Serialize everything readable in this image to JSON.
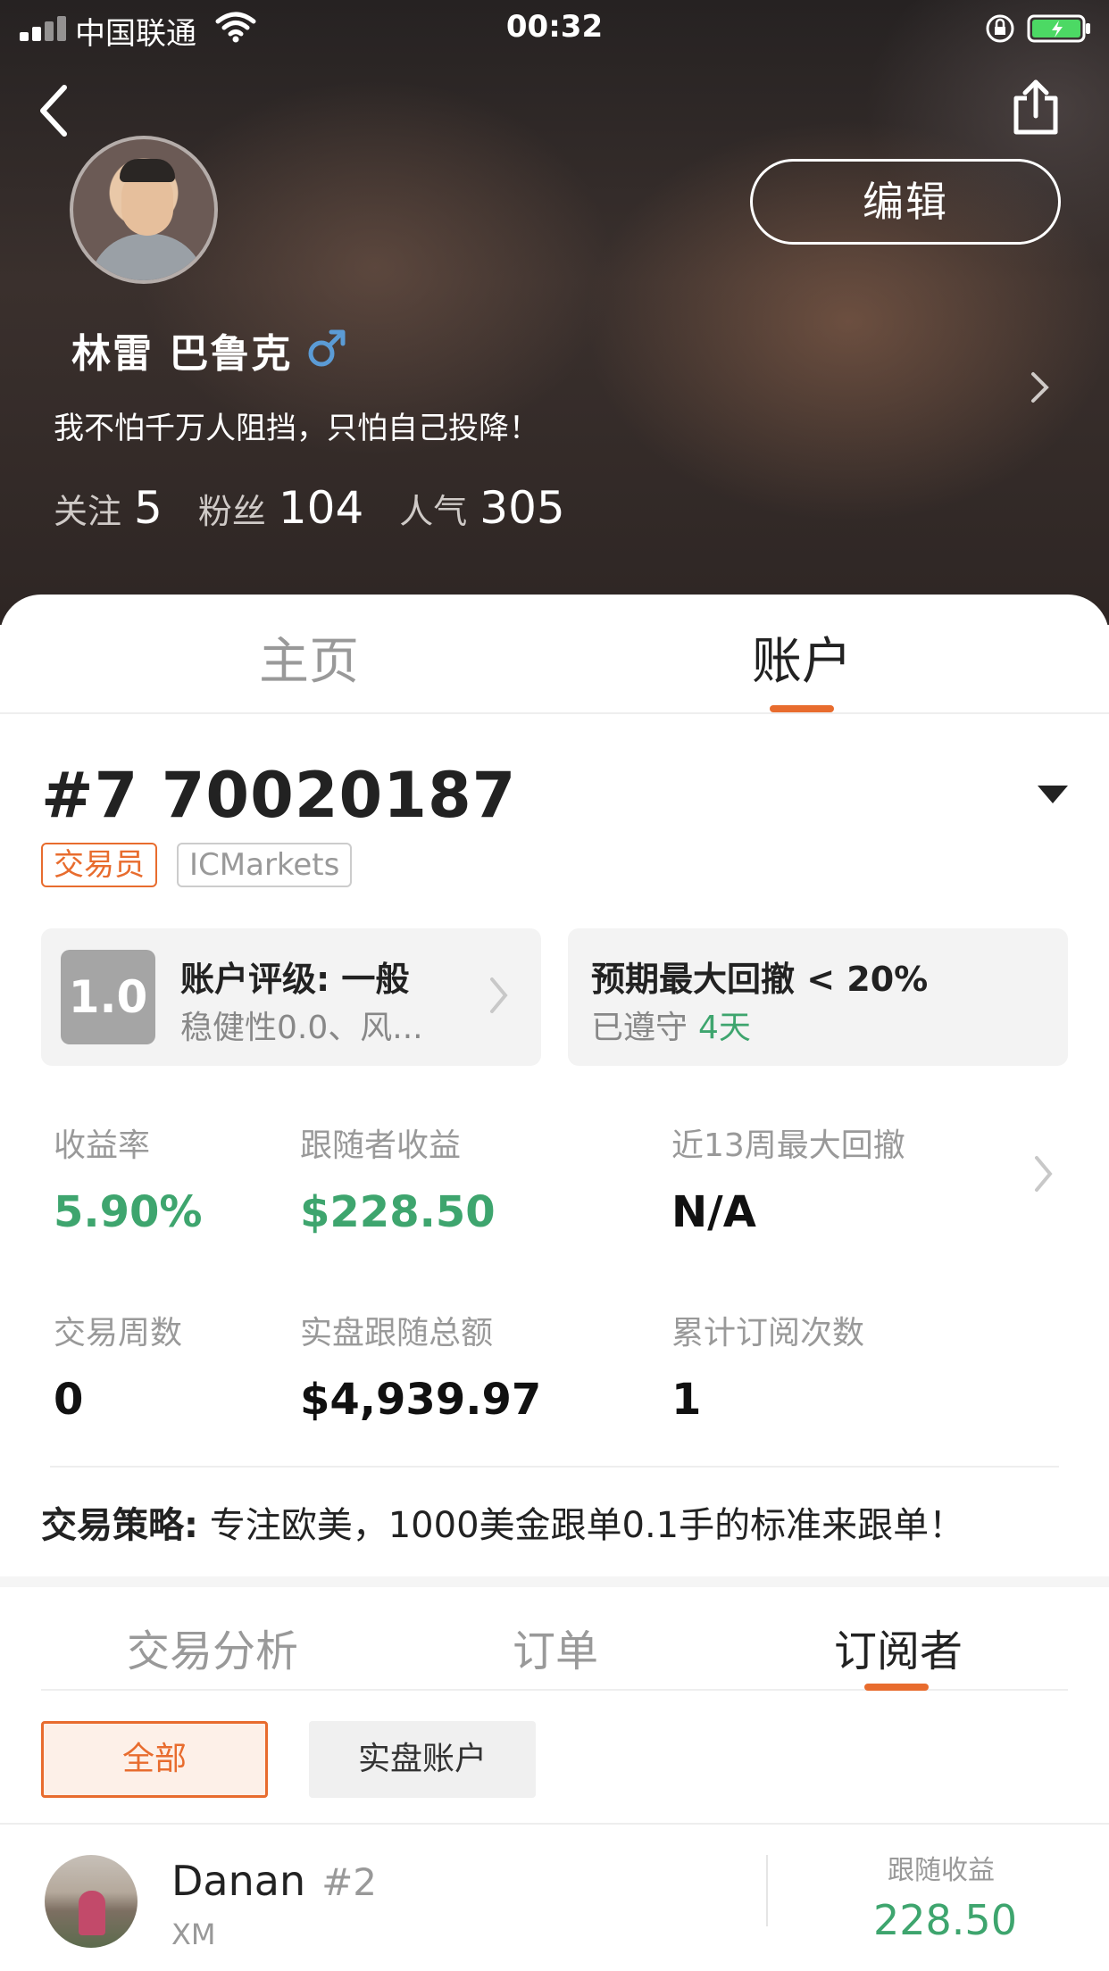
{
  "status_bar": {
    "carrier": "中国联通",
    "time": "00:32"
  },
  "header": {
    "edit_label": "编辑",
    "user_name": "林雷 巴鲁克",
    "gender_symbol": "♂",
    "bio": "我不怕千万人阻挡，只怕自己投降！",
    "stats": {
      "following_label": "关注",
      "following_value": "5",
      "fans_label": "粉丝",
      "fans_value": "104",
      "popularity_label": "人气",
      "popularity_value": "305"
    }
  },
  "main_tabs": [
    {
      "label": "主页",
      "active": false
    },
    {
      "label": "账户",
      "active": true
    }
  ],
  "account": {
    "number": "#7 70020187",
    "role_tag": "交易员",
    "broker_tag": "ICMarkets",
    "rating": {
      "score": "1.0",
      "title": "账户评级: 一般",
      "subtitle": "稳健性0.0、风..."
    },
    "drawdown": {
      "title": "预期最大回撤 < 20%",
      "kept_label": "已遵守",
      "kept_days": "4天"
    },
    "metrics": [
      {
        "label": "收益率",
        "value": "5.90%"
      },
      {
        "label": "跟随者收益",
        "value": "$228.50"
      },
      {
        "label": "近13周最大回撤",
        "value": "N/A"
      },
      {
        "label": "交易周数",
        "value": "0"
      },
      {
        "label": "实盘跟随总额",
        "value": "$4,939.97"
      },
      {
        "label": "累计订阅次数",
        "value": "1"
      }
    ],
    "strategy_label": "交易策略:",
    "strategy_text": "专注欧美，1000美金跟单0.1手的标准来跟单！"
  },
  "sub_tabs": [
    {
      "label": "交易分析",
      "active": false
    },
    {
      "label": "订单",
      "active": false
    },
    {
      "label": "订阅者",
      "active": true
    }
  ],
  "filters": {
    "all": "全部",
    "real": "实盘账户"
  },
  "subscribers": [
    {
      "name": "Danan",
      "rank": "#2",
      "broker": "XM",
      "earnings_label": "跟随收益",
      "earnings_value": "228.50"
    }
  ],
  "colors": {
    "accent": "#e86c2e",
    "positive": "#3ea56e",
    "male_blue": "#5b9bd5"
  }
}
